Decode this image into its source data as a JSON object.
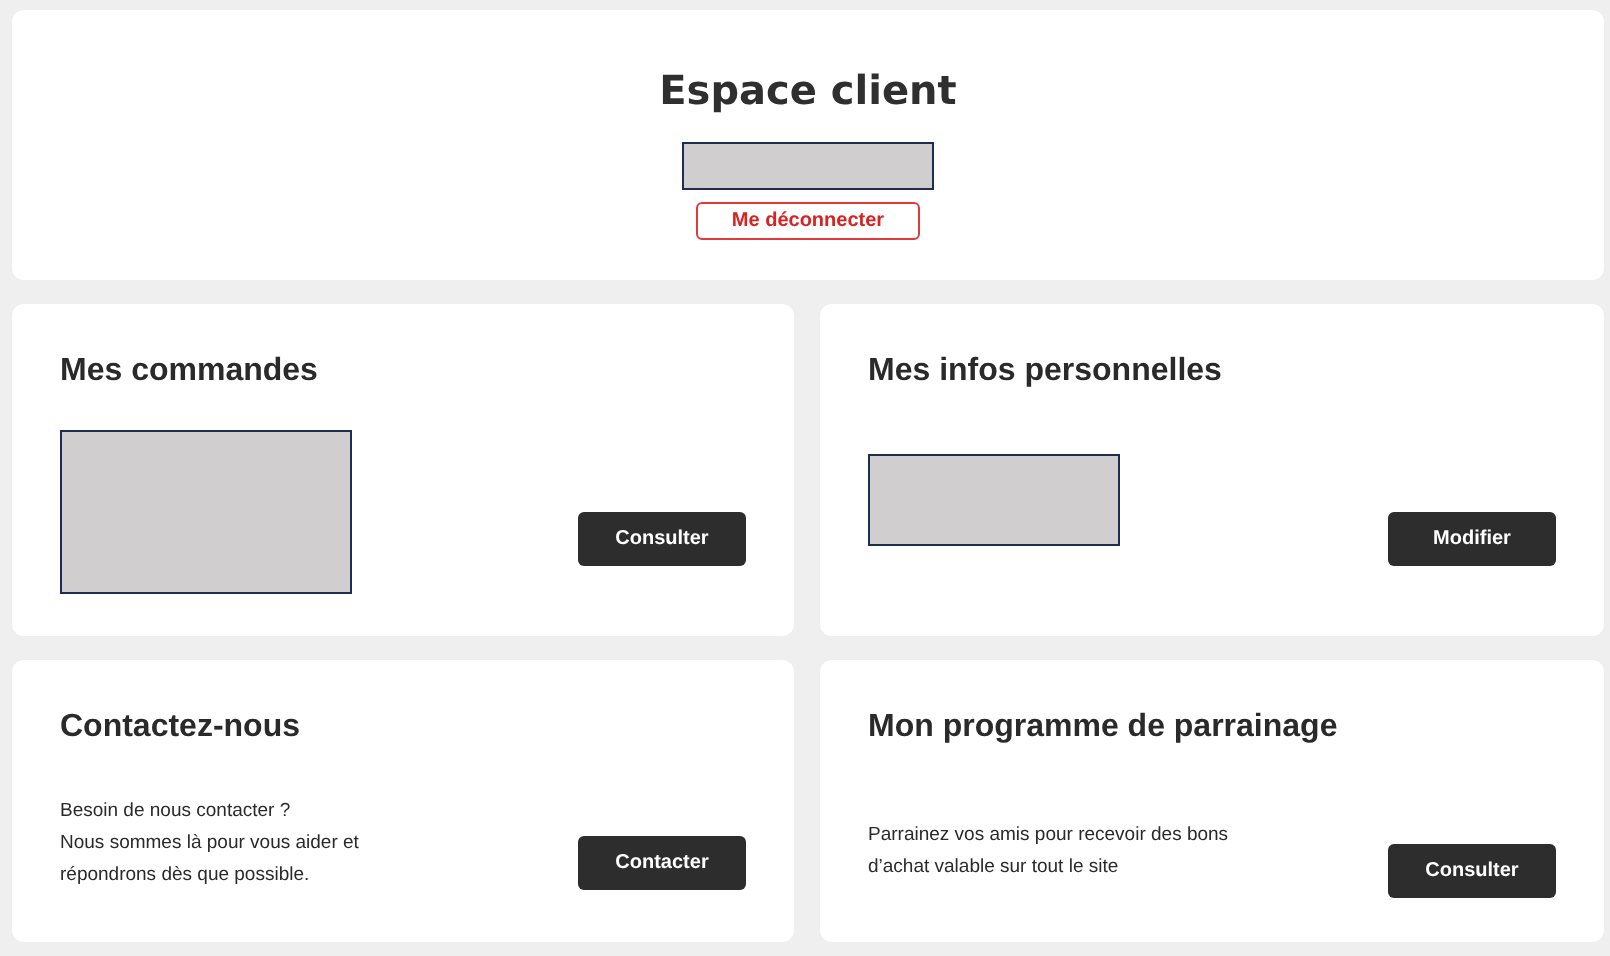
{
  "header": {
    "title": "Espace client",
    "user": {
      "kind": "redacted"
    },
    "logout_button": "Me déconnecter"
  },
  "cards": [
    {
      "title": "Mes commandes",
      "body": {
        "kind": "redacted"
      },
      "button": "Consulter"
    },
    {
      "title": "Mes infos personnelles",
      "body": {
        "kind": "redacted"
      },
      "button": "Modifier"
    },
    {
      "title": "Contactez-nous",
      "body": {
        "kind": "text",
        "lines": [
          "Besoin de nous contacter ?",
          "Nous sommes là pour vous aider et répondrons dès que possible."
        ]
      },
      "button": "Contacter"
    },
    {
      "title": "Mon programme de parrainage",
      "body": {
        "kind": "text",
        "lines": [
          "Parrainez vos amis pour recevoir des bons d’achat valable sur tout le site"
        ]
      },
      "button": "Consulter"
    }
  ]
}
